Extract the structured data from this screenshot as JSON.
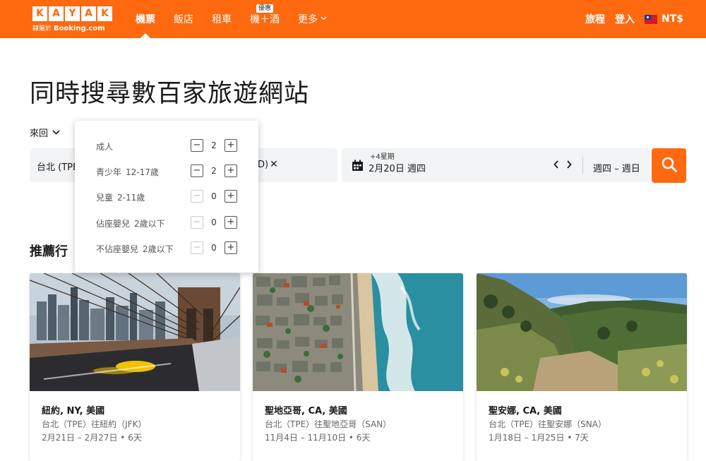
{
  "header": {
    "logo_letters": [
      "K",
      "A",
      "Y",
      "A",
      "K"
    ],
    "logo_sub_left": "隸屬於",
    "logo_sub_brand": "Booking.com",
    "nav": [
      {
        "label": "機票",
        "active": true
      },
      {
        "label": "飯店",
        "active": false
      },
      {
        "label": "租車",
        "active": false
      },
      {
        "label": "機＋酒",
        "badge": "優惠",
        "active": false
      },
      {
        "label": "更多",
        "active": false
      }
    ],
    "trips": "旅程",
    "login": "登入",
    "currency": "NT$",
    "color": "#ff690f"
  },
  "hero": {
    "title": "同時搜尋數百家旅遊網站",
    "trip_type": "來回"
  },
  "search": {
    "origin": "台北 (TPE",
    "dest_tail": "D)",
    "date_hint": "+4星期",
    "date_depart": "2月20日 週四",
    "date_return": "週四 – 週日"
  },
  "travelers": [
    {
      "label": "成人",
      "sub": "",
      "value": "2",
      "minus_enabled": true
    },
    {
      "label": "青少年",
      "sub": "12-17歲",
      "value": "2",
      "minus_enabled": true
    },
    {
      "label": "兒童",
      "sub": "2-11歲",
      "value": "0",
      "minus_enabled": false
    },
    {
      "label": "佔座嬰兒",
      "sub": "2歲以下",
      "value": "0",
      "minus_enabled": false
    },
    {
      "label": "不佔座嬰兒",
      "sub": "2歲以下",
      "value": "0",
      "minus_enabled": false
    }
  ],
  "recommended": {
    "title": "推薦行",
    "cards": [
      {
        "name": "紐約, NY, 美國",
        "route": "台北（TPE）往紐約（JFK）",
        "dates": "2月21日 – 2月27日 • 6天"
      },
      {
        "name": "聖地亞哥, CA, 美國",
        "route": "台北（TPE）往聖地亞哥（SAN）",
        "dates": "11月4日 – 11月10日 • 6天"
      },
      {
        "name": "聖安娜, CA, 美國",
        "route": "台北（TPE）往聖安娜（SNA）",
        "dates": "1月18日 – 1月25日 • 7天"
      }
    ]
  }
}
